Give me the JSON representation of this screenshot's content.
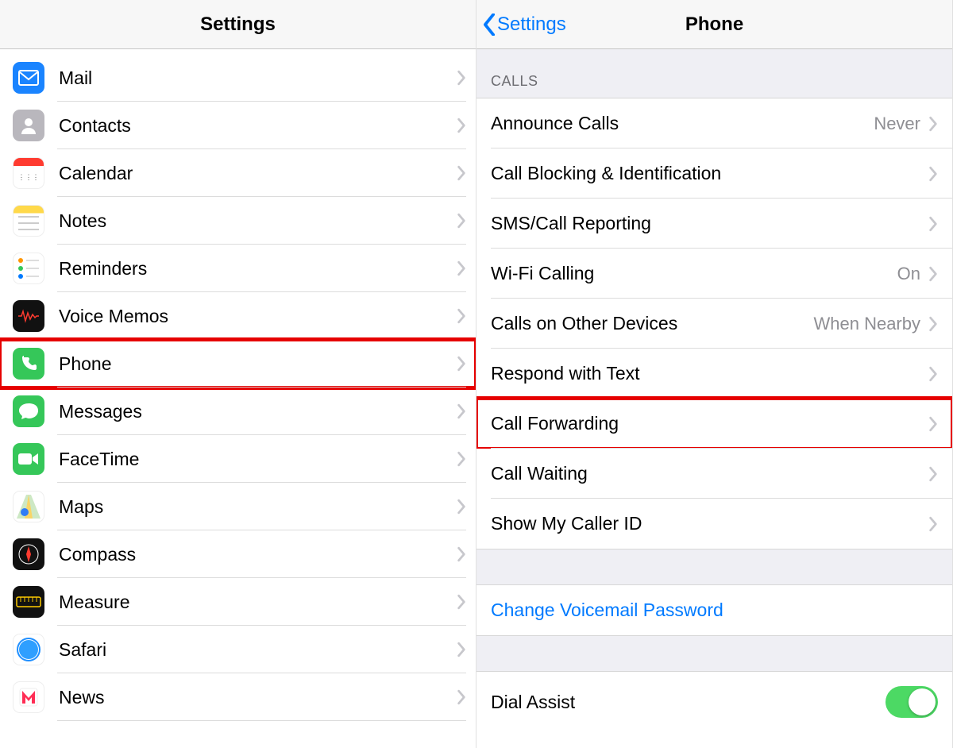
{
  "left": {
    "title": "Settings",
    "items": [
      {
        "id": "mail",
        "label": "Mail",
        "icon": "mail-icon"
      },
      {
        "id": "contacts",
        "label": "Contacts",
        "icon": "contacts-icon"
      },
      {
        "id": "calendar",
        "label": "Calendar",
        "icon": "calendar-icon"
      },
      {
        "id": "notes",
        "label": "Notes",
        "icon": "notes-icon"
      },
      {
        "id": "reminders",
        "label": "Reminders",
        "icon": "reminders-icon"
      },
      {
        "id": "voice",
        "label": "Voice Memos",
        "icon": "voice-memos-icon"
      },
      {
        "id": "phone",
        "label": "Phone",
        "icon": "phone-icon",
        "highlighted": true
      },
      {
        "id": "messages",
        "label": "Messages",
        "icon": "messages-icon"
      },
      {
        "id": "facetime",
        "label": "FaceTime",
        "icon": "facetime-icon"
      },
      {
        "id": "maps",
        "label": "Maps",
        "icon": "maps-icon"
      },
      {
        "id": "compass",
        "label": "Compass",
        "icon": "compass-icon"
      },
      {
        "id": "measure",
        "label": "Measure",
        "icon": "measure-icon"
      },
      {
        "id": "safari",
        "label": "Safari",
        "icon": "safari-icon"
      },
      {
        "id": "news",
        "label": "News",
        "icon": "news-icon"
      }
    ]
  },
  "right": {
    "back_label": "Settings",
    "title": "Phone",
    "section_calls": "CALLS",
    "rows": [
      {
        "id": "announce",
        "label": "Announce Calls",
        "value": "Never",
        "chevron": true
      },
      {
        "id": "blocking",
        "label": "Call Blocking & Identification",
        "value": "",
        "chevron": true
      },
      {
        "id": "sms",
        "label": "SMS/Call Reporting",
        "value": "",
        "chevron": true
      },
      {
        "id": "wifi",
        "label": "Wi-Fi Calling",
        "value": "On",
        "chevron": true
      },
      {
        "id": "other",
        "label": "Calls on Other Devices",
        "value": "When Nearby",
        "chevron": true
      },
      {
        "id": "respond",
        "label": "Respond with Text",
        "value": "",
        "chevron": true
      },
      {
        "id": "forward",
        "label": "Call Forwarding",
        "value": "",
        "chevron": true,
        "highlighted": true
      },
      {
        "id": "waiting",
        "label": "Call Waiting",
        "value": "",
        "chevron": true
      },
      {
        "id": "callerid",
        "label": "Show My Caller ID",
        "value": "",
        "chevron": true
      }
    ],
    "voicemail_label": "Change Voicemail Password",
    "dial_assist_label": "Dial Assist",
    "dial_assist_on": true
  }
}
